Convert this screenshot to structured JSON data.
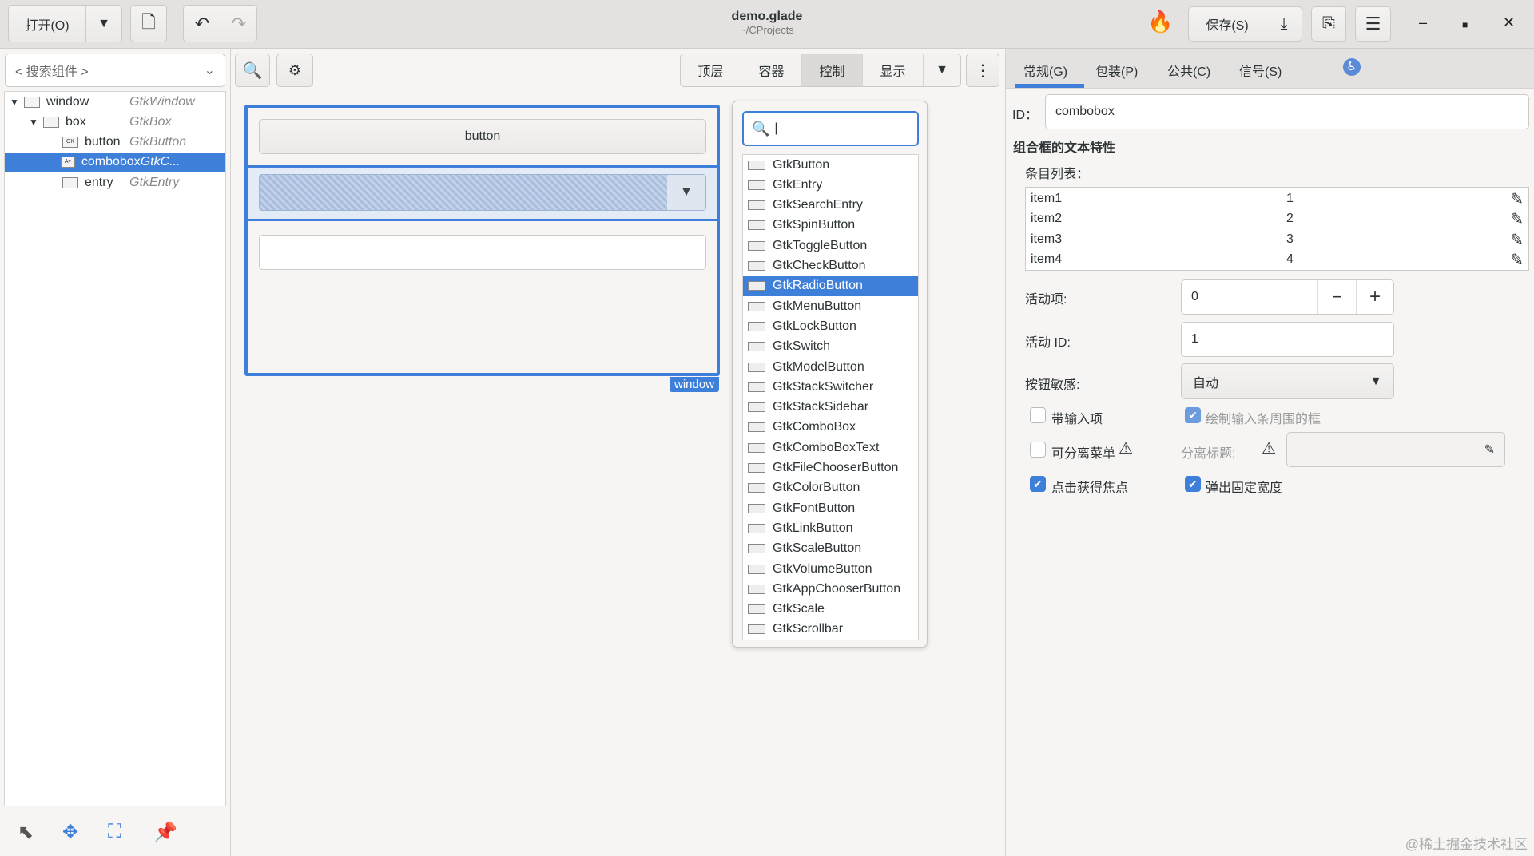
{
  "header": {
    "open": "打开(O)",
    "title": "demo.glade",
    "subtitle": "~/CProjects",
    "save": "保存(S)"
  },
  "left": {
    "search_placeholder": "< 搜索组件 >",
    "tree": [
      {
        "name": "window",
        "type": "GtkWindow",
        "level": 0,
        "expander": true,
        "icon": "window"
      },
      {
        "name": "box",
        "type": "GtkBox",
        "level": 1,
        "expander": true,
        "icon": "box"
      },
      {
        "name": "button",
        "type": "GtkButton",
        "level": 2,
        "icon": "OK"
      },
      {
        "name": "combobox",
        "type": "GtkC...",
        "level": 2,
        "icon": "A▾",
        "selected": true
      },
      {
        "name": "entry",
        "type": "GtkEntry",
        "level": 2,
        "icon": ""
      }
    ]
  },
  "palette": {
    "tabs": [
      "顶层",
      "容器",
      "控制",
      "显示"
    ],
    "active_tab": "控制",
    "search_value": "|",
    "widgets": [
      "GtkButton",
      "GtkEntry",
      "GtkSearchEntry",
      "GtkSpinButton",
      "GtkToggleButton",
      "GtkCheckButton",
      "GtkRadioButton",
      "GtkMenuButton",
      "GtkLockButton",
      "GtkSwitch",
      "GtkModelButton",
      "GtkStackSwitcher",
      "GtkStackSidebar",
      "GtkComboBox",
      "GtkComboBoxText",
      "GtkFileChooserButton",
      "GtkColorButton",
      "GtkFontButton",
      "GtkLinkButton",
      "GtkScaleButton",
      "GtkVolumeButton",
      "GtkAppChooserButton",
      "GtkScale",
      "GtkScrollbar"
    ],
    "selected": "GtkRadioButton"
  },
  "canvas": {
    "button_label": "button",
    "window_label": "window"
  },
  "props": {
    "tabs": [
      "常规(G)",
      "包装(P)",
      "公共(C)",
      "信号(S)"
    ],
    "active_tab": "常规(G)",
    "id_label": "ID：",
    "id_value": "combobox",
    "section": "组合框的文本特性",
    "items_label": "条目列表：",
    "items": [
      {
        "text": "item1",
        "id": "1"
      },
      {
        "text": "item2",
        "id": "2"
      },
      {
        "text": "item3",
        "id": "3"
      },
      {
        "text": "item4",
        "id": "4"
      }
    ],
    "active_label": "活动项:",
    "active_value": "0",
    "active_id_label": "活动 ID:",
    "active_id_value": "1",
    "sensitivity_label": "按钮敏感:",
    "sensitivity_value": "自动",
    "has_entry": {
      "label": "带输入项",
      "checked": false
    },
    "has_frame": {
      "label": "绘制输入条周围的框",
      "checked": true
    },
    "tearoff": {
      "label": "可分离菜单",
      "checked": false
    },
    "tearoff_title_label": "分离标题:",
    "tearoff_title_value": "",
    "focus_on_click": {
      "label": "点击获得焦点",
      "checked": true
    },
    "popup_fixed_width": {
      "label": "弹出固定宽度",
      "checked": true
    }
  },
  "watermark": "@稀土掘金技术社区",
  "accent": "#3d7fd9"
}
